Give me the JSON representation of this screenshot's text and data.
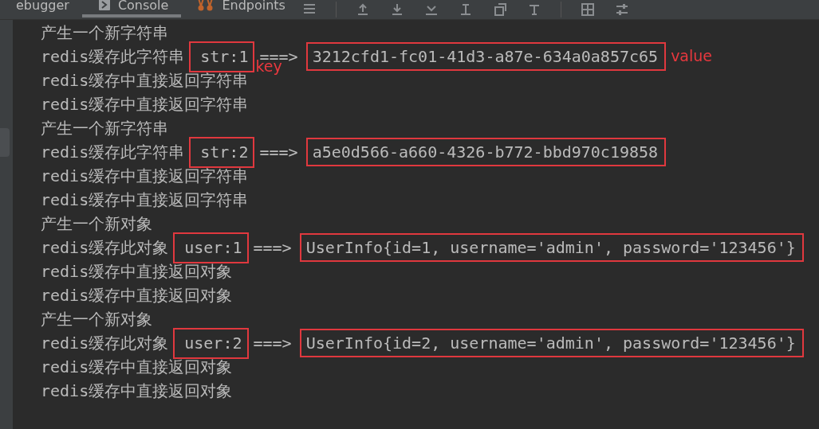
{
  "tabs": [
    {
      "label": "ebugger",
      "selected": false
    },
    {
      "label": "Console",
      "selected": true
    },
    {
      "label": "Endpoints",
      "selected": false
    }
  ],
  "console": {
    "lines": [
      {
        "kind": "text",
        "text": "产生一个新字符串"
      },
      {
        "kind": "entry",
        "prefix": "redis缓存此字符串",
        "key": "str:1",
        "arrow": "===>",
        "value": "3212cfd1-fc01-41d3-a87e-634a0a857c65",
        "key_note": "key",
        "value_note": "value"
      },
      {
        "kind": "text",
        "text": "redis缓存中直接返回字符串"
      },
      {
        "kind": "text",
        "text": "redis缓存中直接返回字符串"
      },
      {
        "kind": "text",
        "text": "产生一个新字符串"
      },
      {
        "kind": "entry",
        "prefix": "redis缓存此字符串",
        "key": "str:2",
        "arrow": "===>",
        "value": "a5e0d566-a660-4326-b772-bbd970c19858"
      },
      {
        "kind": "text",
        "text": "redis缓存中直接返回字符串"
      },
      {
        "kind": "text",
        "text": "redis缓存中直接返回字符串"
      },
      {
        "kind": "text",
        "text": "产生一个新对象"
      },
      {
        "kind": "entry",
        "prefix": "redis缓存此对象",
        "key": "user:1",
        "arrow": "===>",
        "value": "UserInfo{id=1, username='admin', password='123456'}"
      },
      {
        "kind": "text",
        "text": "redis缓存中直接返回对象"
      },
      {
        "kind": "text",
        "text": "redis缓存中直接返回对象"
      },
      {
        "kind": "text",
        "text": "产生一个新对象"
      },
      {
        "kind": "entry",
        "prefix": "redis缓存此对象",
        "key": "user:2",
        "arrow": "===>",
        "value": "UserInfo{id=2, username='admin', password='123456'}"
      },
      {
        "kind": "text",
        "text": "redis缓存中直接返回对象"
      },
      {
        "kind": "text",
        "text": "redis缓存中直接返回对象"
      }
    ]
  }
}
